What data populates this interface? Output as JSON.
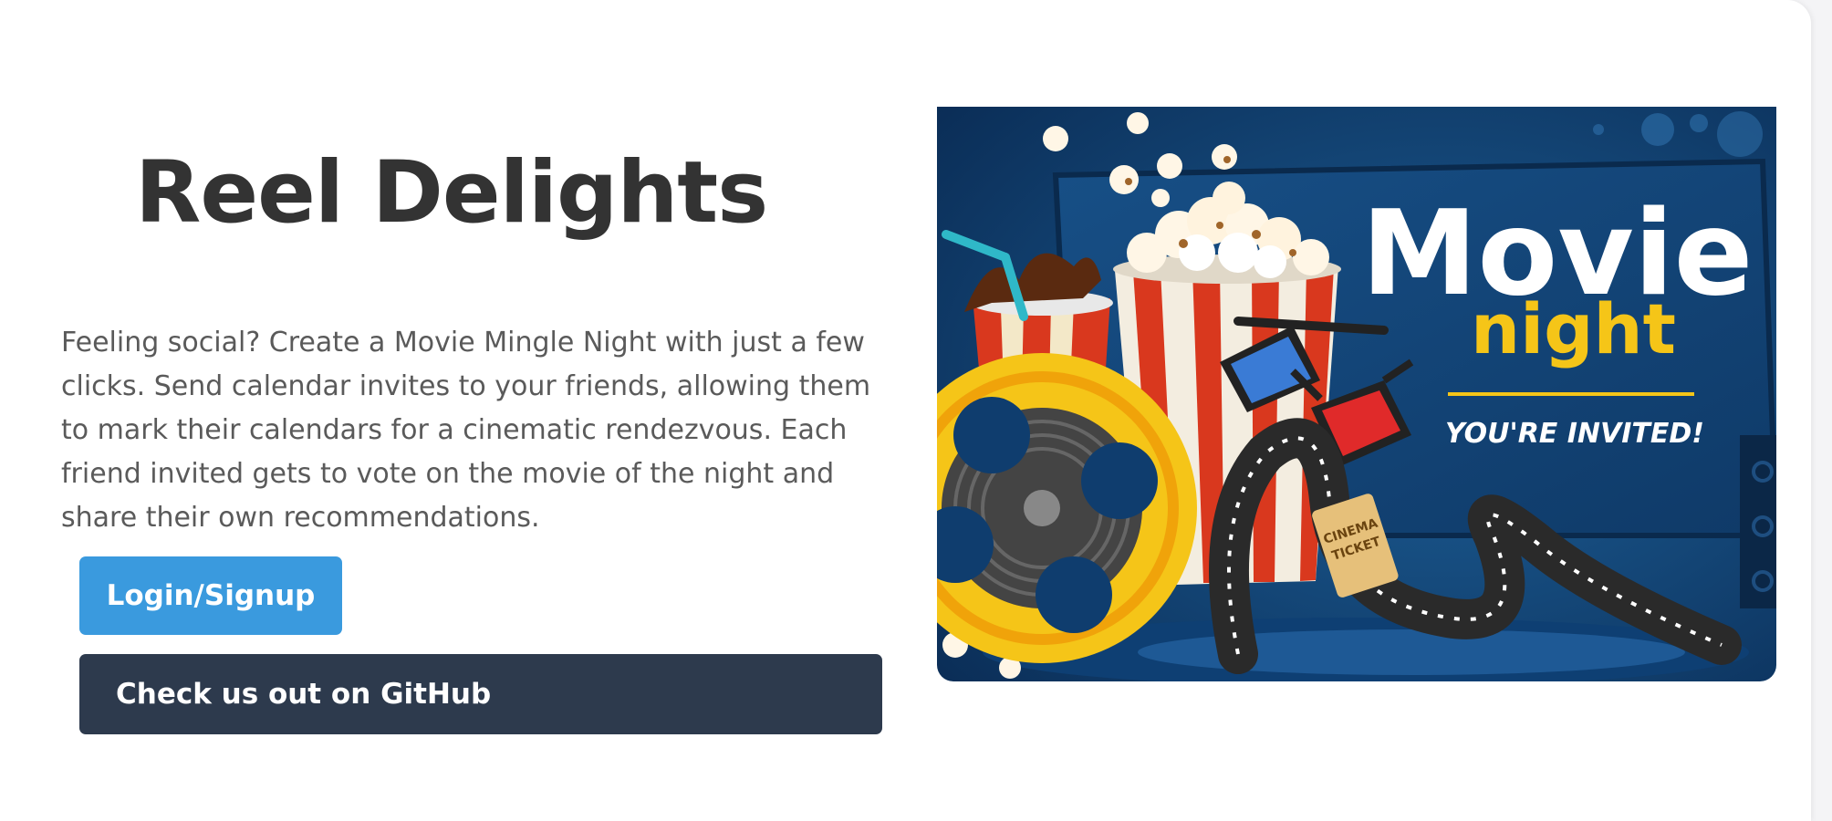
{
  "hero": {
    "title": "Reel Delights",
    "description": "Feeling social? Create a Movie Mingle Night with just a few clicks. Send calendar invites to your friends, allowing them to mark their calendars for a cinematic rendezvous. Each friend invited gets to vote on the movie of the night and share their own recommendations.",
    "login_label": "Login/Signup",
    "github_label": "Check us out on GitHub"
  },
  "poster": {
    "headline_movie": "Movie",
    "headline_night": "night",
    "invite": "YOU'RE INVITED!",
    "ticket_line1": "CINEMA",
    "ticket_line2": "TICKET"
  },
  "colors": {
    "accent": "#3a9ade",
    "dark_button": "#2d3a4d",
    "title": "#333333",
    "body_text": "#5a5a5a",
    "poster_bg": "#0f3d6e",
    "poster_yellow": "#f5c518"
  }
}
